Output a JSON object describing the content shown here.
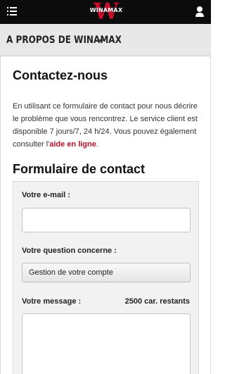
{
  "header": {
    "logo_letter": "W",
    "logo_text": "WINAMAX",
    "brand_color": "#c8102e",
    "menu_icon": "list-menu-icon",
    "user_icon": "user-icon"
  },
  "section": {
    "title": "A PROPOS DE WINAMAX"
  },
  "contact": {
    "title": "Contactez-nous",
    "intro_text": "En utilisant ce formulaire de contact pour nous décrire le problème que vous rencontrez. Le service client est disponible 7 jours/7, 24 h/24. Vous pouvez également consulter l'",
    "help_link": "aide en ligne",
    "intro_end": "."
  },
  "form": {
    "title": "Formulaire de contact",
    "email_label": "Votre e-mail :",
    "email_value": "",
    "question_label": "Votre question concerne :",
    "question_selected": "Gestion de votre compte",
    "message_label": "Votre message :",
    "message_counter": "2500 car. restants",
    "message_value": ""
  }
}
